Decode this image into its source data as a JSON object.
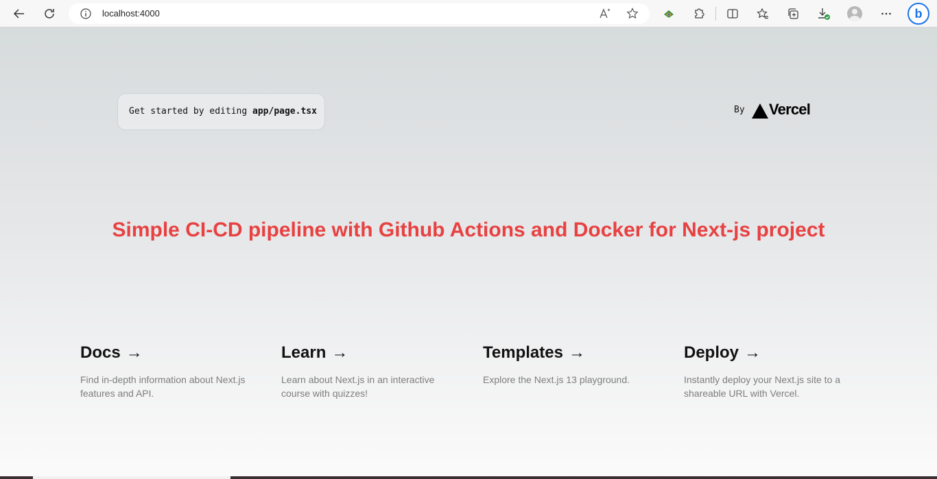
{
  "browser": {
    "url": "localhost:4000",
    "icons": [
      "back-icon",
      "refresh-icon",
      "info-icon",
      "read-aloud-icon",
      "favorite-star-icon",
      "extension-app-icon",
      "extensions-icon",
      "split-screen-icon",
      "favorites-icon",
      "collections-icon",
      "downloads-icon",
      "profile-avatar",
      "more-icon",
      "bing-copilot-icon"
    ]
  },
  "header": {
    "code_prefix": "Get started by editing ",
    "code_file": "app/page.tsx",
    "by_label": "By",
    "brand": "Vercel"
  },
  "hero": {
    "title": "Simple CI-CD pipeline with Github Actions and Docker for Next-js project",
    "color": "#e84141"
  },
  "cards": [
    {
      "title": "Docs",
      "arrow": "->",
      "description": "Find in-depth information about Next.js features and API."
    },
    {
      "title": "Learn",
      "arrow": "->",
      "description": "Learn about Next.js in an interactive course with quizzes!"
    },
    {
      "title": "Templates",
      "arrow": "->",
      "description": "Explore the Next.js 13 playground."
    },
    {
      "title": "Deploy",
      "arrow": "->",
      "description": "Instantly deploy your Next.js site to a shareable URL with Vercel."
    }
  ]
}
